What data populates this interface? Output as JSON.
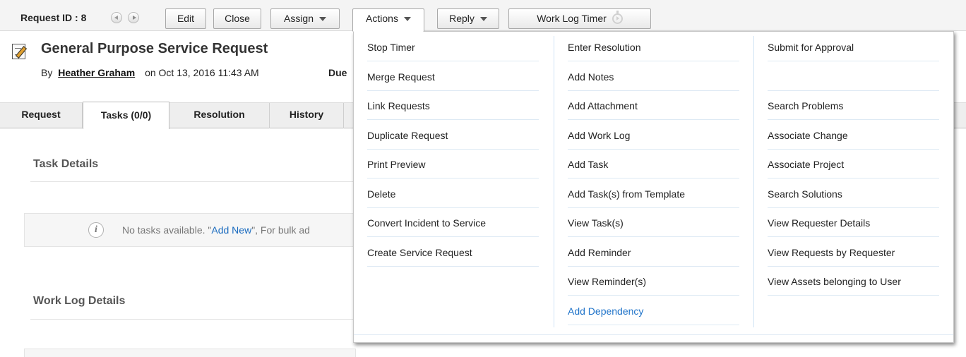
{
  "toolbar": {
    "request_id": "Request ID : 8",
    "buttons": {
      "edit": "Edit",
      "close": "Close",
      "assign": "Assign",
      "actions": "Actions",
      "reply": "Reply",
      "work_log_timer": "Work Log Timer"
    }
  },
  "header": {
    "title": "General Purpose Service Request",
    "by_label": "By",
    "author": "Heather Graham",
    "on_label": "on",
    "created": "Oct 13, 2016 11:43 AM",
    "due_label": "Due"
  },
  "tabs": [
    "Request",
    "Tasks (0/0)",
    "Resolution",
    "History"
  ],
  "active_tab": "Tasks (0/0)",
  "content": {
    "task_details_title": "Task Details",
    "no_tasks_prefix": "No tasks available. \"",
    "add_new_link": "Add New",
    "no_tasks_suffix": "\", For bulk ad",
    "work_log_title": "Work Log Details"
  },
  "actions_menu": {
    "col1": [
      "Stop Timer",
      "Merge Request",
      "Link Requests",
      "Duplicate Request",
      "Print Preview",
      "Delete",
      "Convert Incident to Service",
      "Create Service Request"
    ],
    "col2": [
      "Enter Resolution",
      "Add Notes",
      "Add Attachment",
      "Add Work Log",
      "Add Task",
      "Add Task(s) from Template",
      "View Task(s)",
      "Add Reminder",
      "View Reminder(s)",
      "Add Dependency"
    ],
    "col3": [
      "Submit for Approval",
      "",
      "Search Problems",
      "Associate Change",
      "Associate Project",
      "Search Solutions",
      "View Requester Details",
      "View Requests by Requester",
      "View Assets belonging to User"
    ],
    "link_color": "#1f73c9"
  }
}
